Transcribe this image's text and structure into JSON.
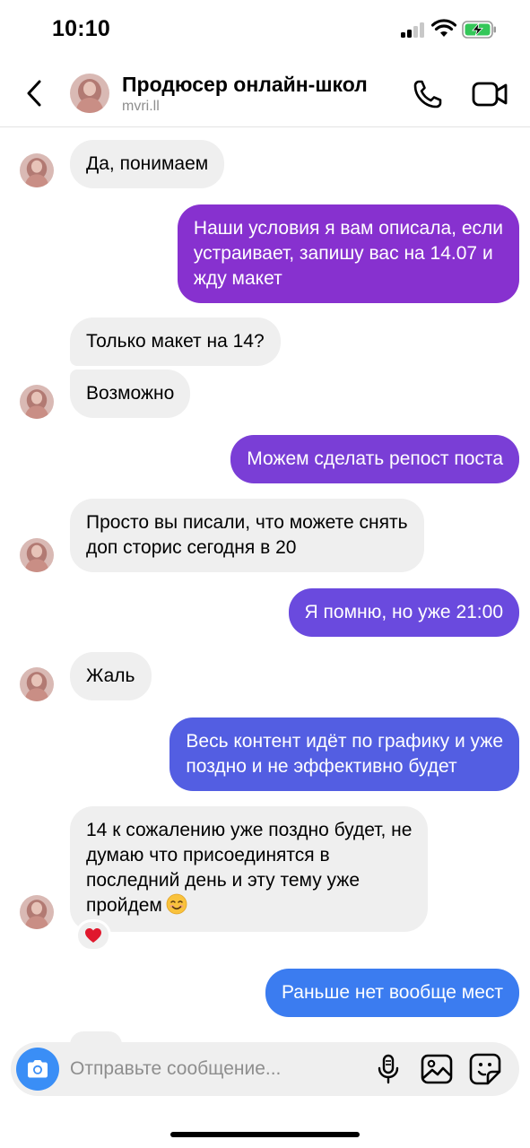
{
  "status_bar": {
    "time": "10:10"
  },
  "header": {
    "contact_name": "Продюсер онлайн-школ",
    "contact_handle": "mvri.ll"
  },
  "messages": [
    {
      "direction": "incoming",
      "text": "Да, понимаем"
    },
    {
      "direction": "outgoing",
      "lines": [
        "Наши условия я вам описала, если",
        "устраивает, запишу вас на 14.07 и",
        "жду макет"
      ]
    },
    {
      "direction": "incoming",
      "text": "Только макет на 14?"
    },
    {
      "direction": "incoming",
      "text": "Возможно"
    },
    {
      "direction": "outgoing",
      "text": "Можем сделать репост поста"
    },
    {
      "direction": "incoming",
      "lines": [
        "Просто вы писали, что можете снять",
        "доп сторис сегодня в 20"
      ]
    },
    {
      "direction": "outgoing",
      "text": "Я помню, но уже 21:00"
    },
    {
      "direction": "incoming",
      "text": "Жаль"
    },
    {
      "direction": "outgoing",
      "lines": [
        "Весь контент идёт по графику и уже",
        "поздно и не эффективно будет"
      ]
    },
    {
      "direction": "incoming",
      "lines": [
        "14 к сожалению уже поздно будет, не",
        "думаю что присоединятся в",
        "последний день и эту тему уже",
        "пройдем"
      ],
      "emoji": "smiling-face-emoji",
      "reaction": "heart"
    },
    {
      "direction": "outgoing",
      "text": "Раньше нет вообще мест"
    }
  ],
  "composer": {
    "placeholder": "Отправьте сообщение..."
  },
  "colors": {
    "incoming_bubble": "#efefef",
    "outgoing_gradient": [
      "#8a2fd0",
      "#7a3fd6",
      "#6a4ede",
      "#5a5be4",
      "#4a67e8",
      "#3a7af0"
    ],
    "camera_button": "#3a8ef6"
  }
}
